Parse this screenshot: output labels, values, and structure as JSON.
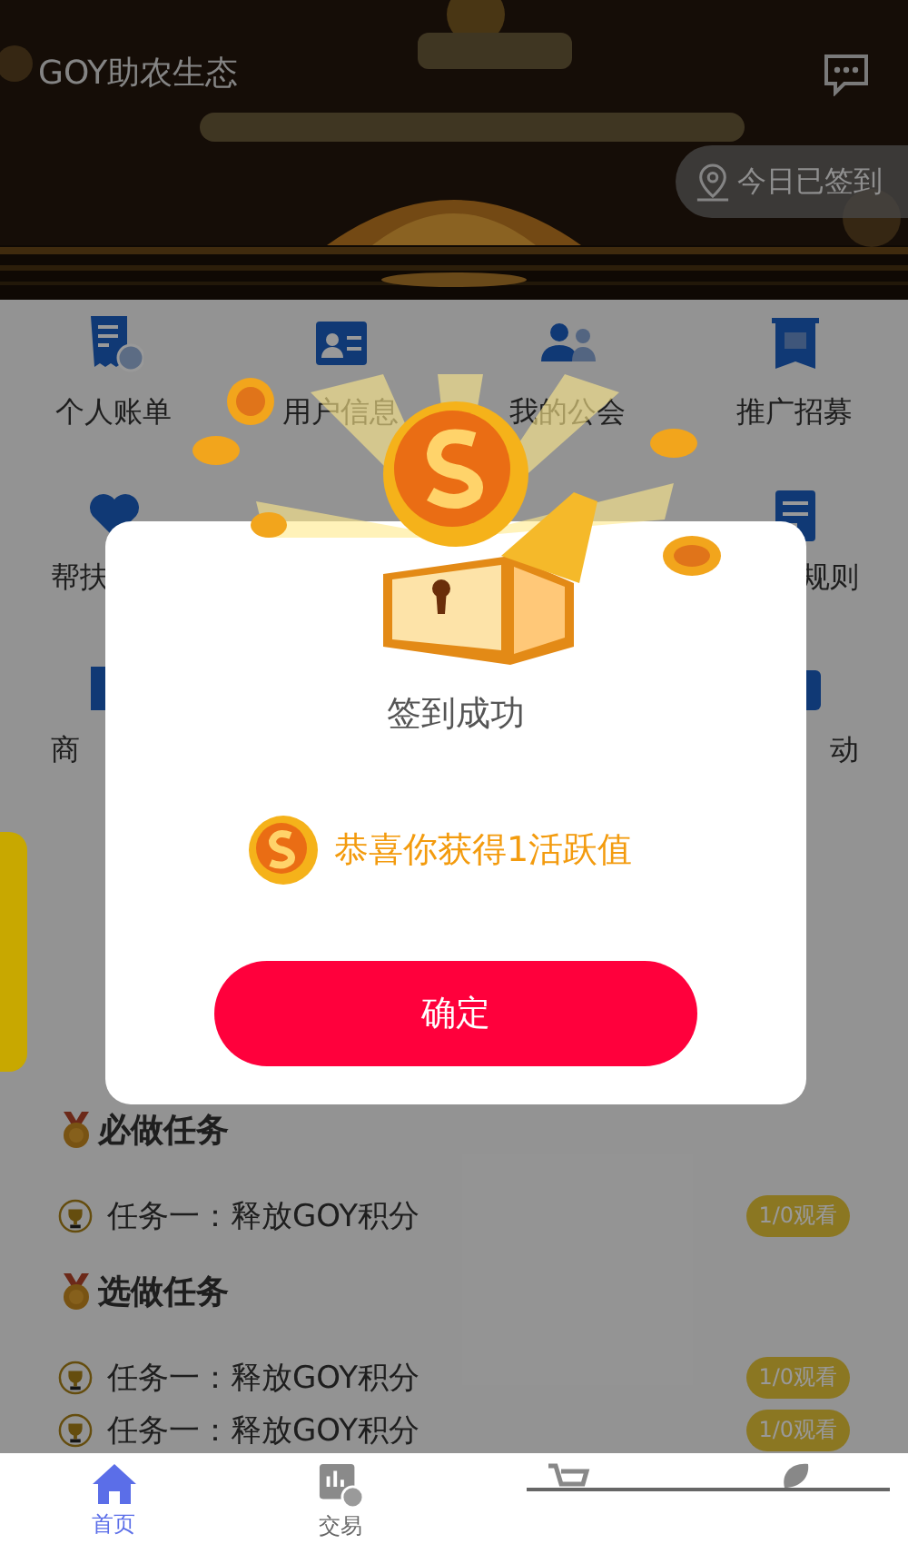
{
  "header": {
    "title": "GOY助农生态",
    "checkin": "今日已签到"
  },
  "menu": [
    {
      "kind": "bill",
      "label": "个人账单"
    },
    {
      "kind": "card",
      "label": "用户信息"
    },
    {
      "kind": "people",
      "label": "我的公会"
    },
    {
      "kind": "recruit",
      "label": "推广招募"
    },
    {
      "kind": "heart",
      "label": "帮扶"
    },
    {
      "kind": "hidden"
    },
    {
      "kind": "hidden"
    },
    {
      "kind": "doc",
      "label": "规则"
    },
    {
      "kind": "shop",
      "label": "商"
    },
    {
      "kind": "hidden"
    },
    {
      "kind": "hidden"
    },
    {
      "kind": "camera",
      "label": "动"
    }
  ],
  "sections": [
    {
      "title": "必做任务",
      "tasks": [
        {
          "name": "任务一：释放GOY积分",
          "badge": "1/0观看"
        }
      ]
    },
    {
      "title": "选做任务",
      "tasks": [
        {
          "name": "任务一：释放GOY积分",
          "badge": "1/0观看"
        },
        {
          "name": "任务一：释放GOY积分",
          "badge": "1/0观看"
        }
      ]
    }
  ],
  "dialog": {
    "title": "签到成功",
    "reward": "恭喜你获得1活跃值",
    "button": "确定"
  },
  "tabbar": [
    {
      "kind": "home",
      "label": "首页",
      "selected": true
    },
    {
      "kind": "trade",
      "label": "交易",
      "selected": false
    },
    {
      "kind": "cart",
      "selected": false
    },
    {
      "kind": "leaf",
      "selected": false
    }
  ]
}
